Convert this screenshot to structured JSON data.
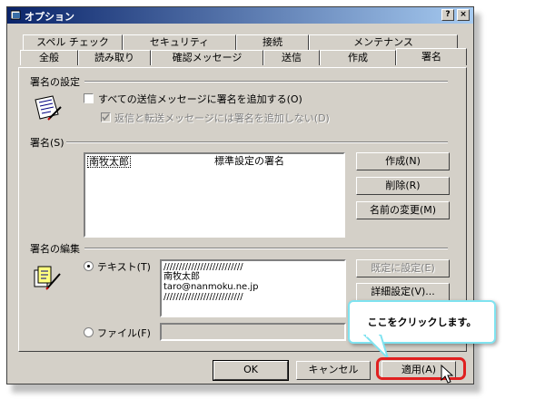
{
  "window": {
    "title": "オプション",
    "help_label": "?",
    "close_label": "×"
  },
  "tabs": {
    "row1": [
      "スペル チェック",
      "セキュリティ",
      "接続",
      "メンテナンス"
    ],
    "row2": [
      "全般",
      "読み取り",
      "確認メッセージ",
      "送信",
      "作成",
      "署名"
    ],
    "active": "署名"
  },
  "signature_settings": {
    "title": "署名の設定",
    "add_to_all": "すべての送信メッセージに署名を追加する(O)",
    "no_reply_forward": "返信と転送メッセージには署名を追加しない(D)"
  },
  "signatures": {
    "title": "署名(S)",
    "items": [
      {
        "name": "南牧太郎",
        "status": "標準設定の署名"
      }
    ],
    "create_button": "作成(N)",
    "delete_button": "削除(R)",
    "rename_button": "名前の変更(M)"
  },
  "edit_signature": {
    "title": "署名の編集",
    "text_option": "テキスト(T)",
    "text_content": "//////////////////////////\n南牧太郎\ntaro@nanmoku.ne.jp\n//////////////////////////",
    "set_default_button": "既定に設定(E)",
    "advanced_button": "詳細設定(V)...",
    "file_option": "ファイル(F)"
  },
  "footer": {
    "ok": "OK",
    "cancel": "キャンセル",
    "apply": "適用(A)"
  },
  "annotation": {
    "callout_text": "ここをクリックします。",
    "highlight_color": "#e02020",
    "callout_border_color": "#7fe3f0"
  }
}
